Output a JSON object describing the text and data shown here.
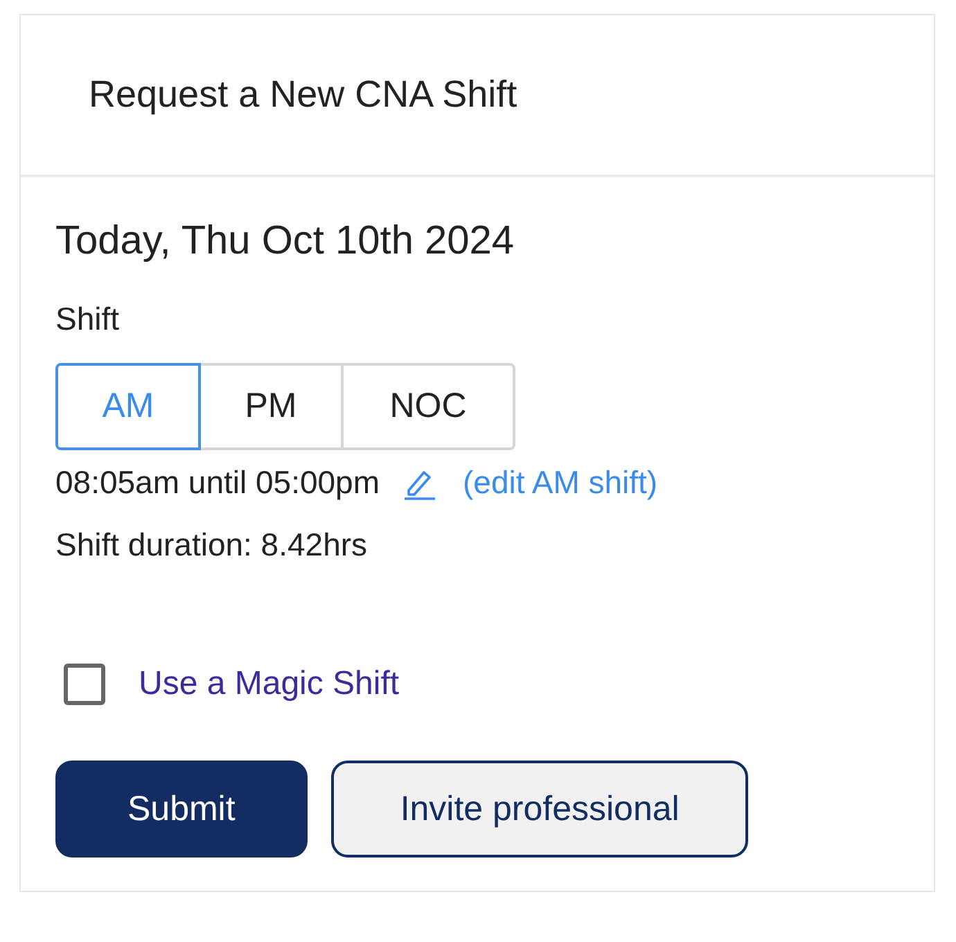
{
  "card": {
    "title": "Request a New CNA Shift"
  },
  "date": "Today, Thu Oct 10th 2024",
  "shift_label": "Shift",
  "shifts": [
    {
      "label": "AM",
      "selected": true
    },
    {
      "label": "PM",
      "selected": false
    },
    {
      "label": "NOC",
      "selected": false
    }
  ],
  "time_range": "08:05am until 05:00pm",
  "edit_link": "(edit AM shift)",
  "duration": "Shift duration: 8.42hrs",
  "magic_shift": {
    "label": "Use a Magic Shift",
    "checked": false
  },
  "buttons": [
    {
      "label": "Submit",
      "kind": "primary"
    },
    {
      "label": "Invite professional",
      "kind": "secondary"
    }
  ]
}
